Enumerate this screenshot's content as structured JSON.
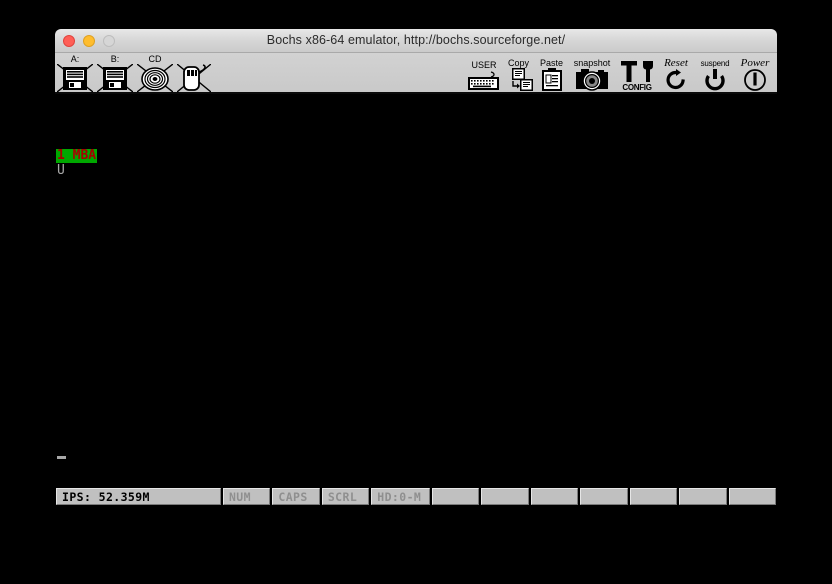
{
  "window": {
    "title": "Bochs x86-64 emulator, http://bochs.sourceforge.net/",
    "controls": {
      "close": "close-button",
      "minimize": "minimize-button",
      "maximize": "maximize-button"
    }
  },
  "toolbar": {
    "left_items": [
      {
        "label": "A:",
        "icon": "floppy-a-icon"
      },
      {
        "label": "B:",
        "icon": "floppy-b-icon"
      },
      {
        "label": "CD",
        "icon": "cdrom-icon"
      },
      {
        "label": "",
        "icon": "mouse-icon"
      }
    ],
    "right_items": [
      {
        "label": "USER",
        "icon": "keyboard-icon",
        "sublabel": ""
      },
      {
        "label": "Copy",
        "icon": "copy-icon",
        "sublabel": ""
      },
      {
        "label": "Paste",
        "icon": "paste-icon",
        "sublabel": ""
      },
      {
        "label": "snapshot",
        "icon": "camera-icon",
        "sublabel": ""
      },
      {
        "label": "",
        "icon": "config-tools-icon",
        "sublabel": "CONFIG"
      },
      {
        "label": "Reset",
        "icon": "reset-icon",
        "sublabel": ""
      },
      {
        "label": "suspend",
        "icon": "suspend-icon",
        "sublabel": ""
      },
      {
        "label": "Power",
        "icon": "power-icon",
        "sublabel": ""
      }
    ]
  },
  "screen": {
    "banner_text": "1 MBA",
    "prompt_char": "U",
    "banner_bg": "#00a800",
    "banner_fg": "#a80000",
    "text_fg": "#a8a8a8",
    "background": "#000000"
  },
  "statusbar": {
    "ips": "IPS: 52.359M",
    "indicators": [
      {
        "label": "NUM",
        "active": false
      },
      {
        "label": "CAPS",
        "active": false
      },
      {
        "label": "SCRL",
        "active": false
      }
    ],
    "hd": "HD:0-M",
    "blank_cells": [
      "",
      "",
      "",
      "",
      "",
      "",
      ""
    ]
  }
}
